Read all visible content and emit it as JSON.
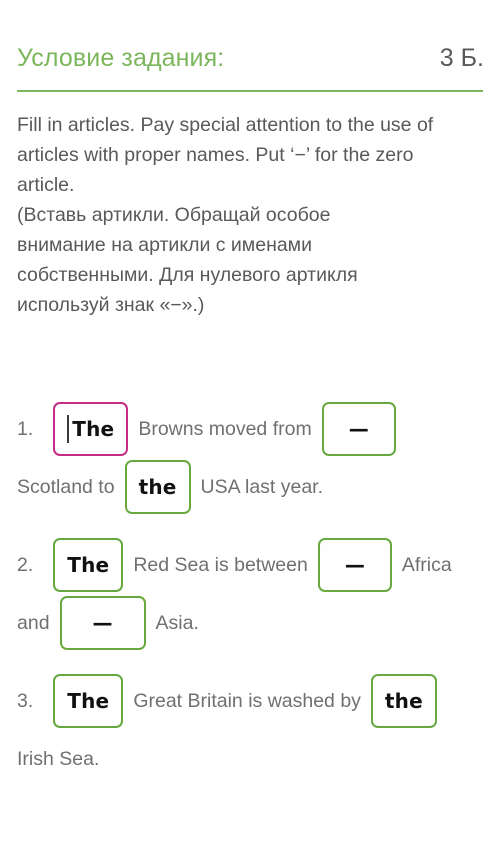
{
  "header": {
    "title": "Условие задания:",
    "score": "3 Б."
  },
  "task": {
    "instruction_en": "Fill in articles. Pay special attention to the use of articles with proper names. Put ‘−’ for the zero article.",
    "instruction_ru": "(Вставь артикли. Обращай особое внимание на артикли с именами собственными. Для нулевого артикля используй знак «−».)"
  },
  "questions": [
    {
      "number": "1.",
      "segments": [
        {
          "kind": "input",
          "value": "The",
          "state": "focused",
          "caret": true
        },
        {
          "kind": "text",
          "value": "Browns moved from"
        },
        {
          "kind": "input",
          "value": "—",
          "state": "filled"
        },
        {
          "kind": "text",
          "value": "Scotland to"
        },
        {
          "kind": "input",
          "value": "the",
          "state": "filled"
        },
        {
          "kind": "text",
          "value": "USA last year."
        }
      ]
    },
    {
      "number": "2.",
      "segments": [
        {
          "kind": "input",
          "value": "The",
          "state": "filled"
        },
        {
          "kind": "text",
          "value": "Red Sea is between"
        },
        {
          "kind": "input",
          "value": "—",
          "state": "filled"
        },
        {
          "kind": "text",
          "value": "Africa"
        },
        {
          "kind": "text",
          "value": "and"
        },
        {
          "kind": "input",
          "value": "—",
          "state": "filled"
        },
        {
          "kind": "text",
          "value": "Asia."
        }
      ]
    },
    {
      "number": "3.",
      "segments": [
        {
          "kind": "input",
          "value": "The",
          "state": "filled"
        },
        {
          "kind": "text",
          "value": "Great Britain is washed by"
        },
        {
          "kind": "input",
          "value": "the",
          "state": "filled"
        },
        {
          "kind": "text",
          "value": "Irish Sea."
        }
      ]
    }
  ],
  "colors": {
    "accent_green": "#7cb65c",
    "border_green": "#68a93f",
    "focus_magenta": "#c42c87",
    "text_gray": "#58595b",
    "background": "#ffffff"
  }
}
